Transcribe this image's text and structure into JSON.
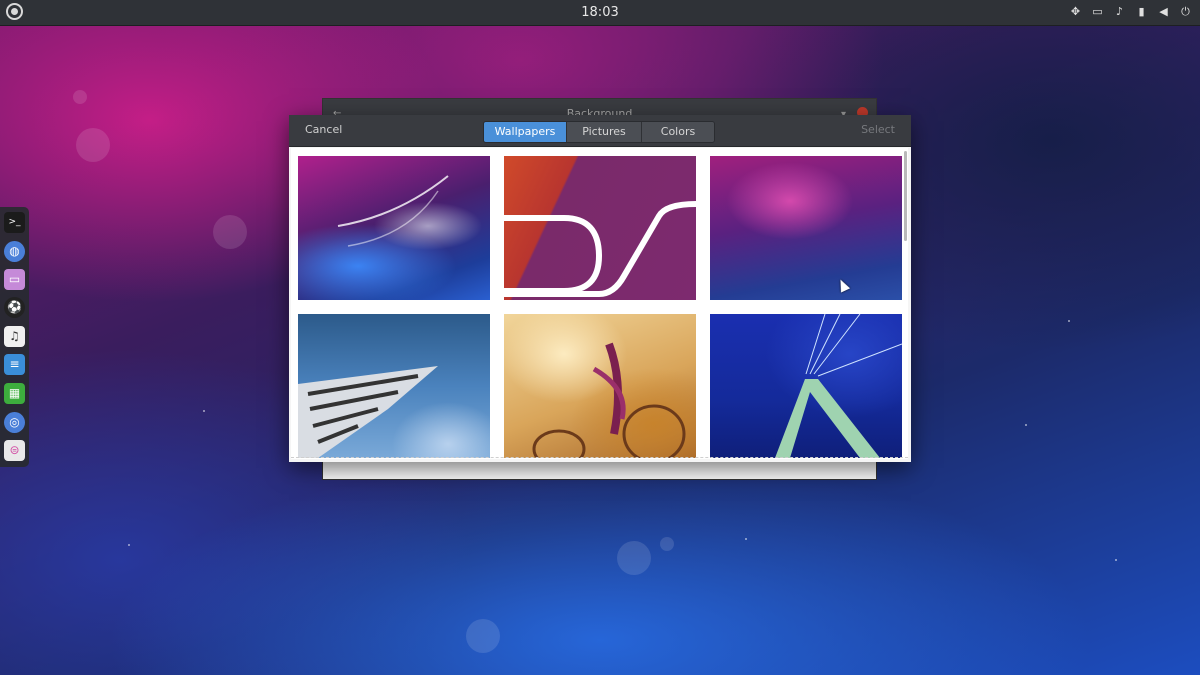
{
  "top_panel": {
    "clock": "18:03",
    "tray_icons": [
      "network-icon",
      "notifications-icon",
      "bell-icon",
      "battery-icon",
      "volume-icon",
      "power-icon"
    ]
  },
  "dock": {
    "items": [
      "terminal-icon",
      "web-browser-icon",
      "files-icon",
      "soccer-game-icon",
      "music-icon",
      "text-editor-icon",
      "spreadsheet-icon",
      "chrome-icon",
      "settings-icon"
    ]
  },
  "background_window": {
    "title": "Background"
  },
  "dialog": {
    "cancel_label": "Cancel",
    "select_label": "Select",
    "tabs": [
      {
        "label": "Wallpapers",
        "active": true
      },
      {
        "label": "Pictures",
        "active": false
      },
      {
        "label": "Colors",
        "active": false
      }
    ],
    "thumbnails": [
      "abstract-magenta-blue-wallpaper",
      "purple-red-ribbon-wallpaper",
      "magenta-blue-pattern-wallpaper",
      "building-facade-sky-wallpaper",
      "golden-macro-plant-wallpaper",
      "blue-sky-structure-wallpaper"
    ]
  },
  "colors": {
    "accent": "#4a90d9",
    "panel": "#2f3237",
    "dialog_header": "#393b40"
  }
}
